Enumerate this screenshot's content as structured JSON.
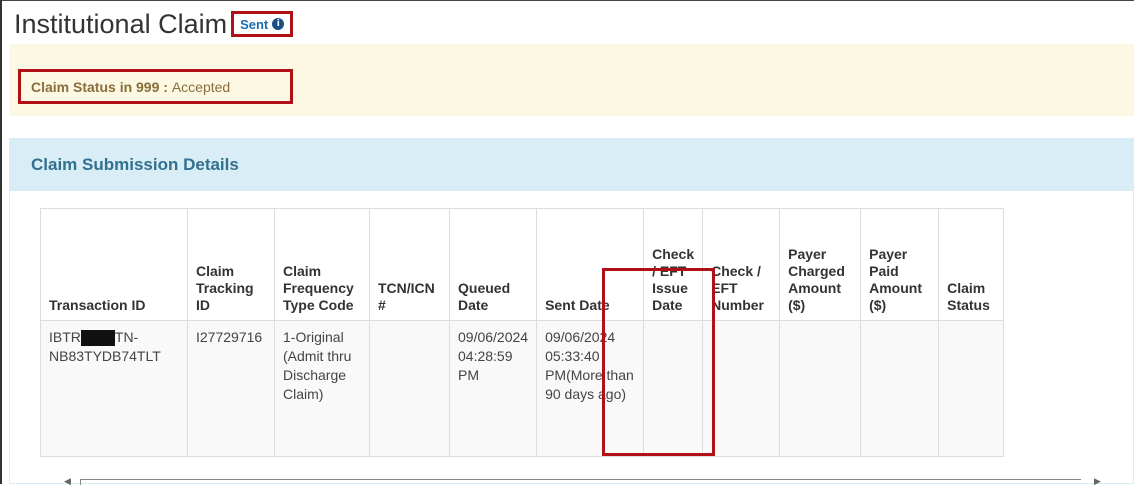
{
  "header": {
    "title": "Institutional Claim",
    "status_label": "Sent",
    "info_icon": "info-circle-icon"
  },
  "status_bar": {
    "label": "Claim Status in 999 :",
    "value": "Accepted"
  },
  "panel": {
    "title": "Claim Submission Details"
  },
  "table": {
    "columns": [
      "Transaction ID",
      "Claim Tracking ID",
      "Claim Frequency Type Code",
      "TCN/ICN #",
      "Queued Date",
      "Sent Date",
      "Check / EFT Issue Date",
      "Check / EFT Number",
      "Payer Charged Amount ($)",
      "Payer Paid Amount ($)",
      "Claim Status"
    ],
    "rows": [
      {
        "transaction_id_prefix": "IBTR",
        "transaction_id_suffix": "TN-NB83TYDB74TLT",
        "claim_tracking_id": "I27729716",
        "frequency_code": "1-Original (Admit thru Discharge Claim)",
        "tcn_icn": "",
        "queued_date": "09/06/2024 04:28:59 PM",
        "sent_date": "09/06/2024 05:33:40 PM(More than 90 days ago)",
        "check_issue_date": "",
        "check_number": "",
        "charged_amount": "",
        "paid_amount": "",
        "claim_status": ""
      }
    ]
  },
  "colors": {
    "highlight": "#b11116",
    "warning_bg": "#fcf8e3",
    "warning_text": "#8a6d3b",
    "info_bg": "#d9edf7",
    "info_text": "#31708f",
    "link": "#1a6ab0"
  }
}
